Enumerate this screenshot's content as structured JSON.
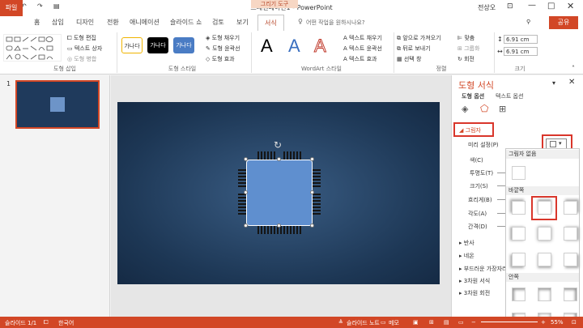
{
  "window": {
    "title": "프레젠테이션1 - PowerPoint",
    "context_tool": "그리기 도구",
    "user": "전상오"
  },
  "tabs": [
    "파일",
    "홈",
    "삽입",
    "디자인",
    "전환",
    "애니메이션",
    "슬라이드 쇼",
    "검토",
    "보기",
    "서식"
  ],
  "tell_me": "어떤 작업을 원하시나요?",
  "share": "공유",
  "ribbon": {
    "insert_shapes": {
      "label": "도형 삽입",
      "edit": "도형 편집",
      "textbox": "텍스트 상자",
      "merge": "도형 병합"
    },
    "shape_styles": {
      "label": "도형 스타일",
      "samples": [
        "가나다",
        "가나다",
        "가나다"
      ],
      "fill": "도형 채우기",
      "outline": "도형 윤곽선",
      "effects": "도형 효과"
    },
    "wordart": {
      "label": "WordArt 스타일",
      "letters": [
        "A",
        "A",
        "A"
      ],
      "text_fill": "텍스트 채우기",
      "text_outline": "텍스트 윤곽선",
      "text_effects": "텍스트 효과"
    },
    "arrange": {
      "label": "정렬",
      "bring_forward": "앞으로 가져오기",
      "send_backward": "뒤로 보내기",
      "selection_pane": "선택 창",
      "align": "맞춤",
      "group": "그룹화",
      "rotate": "회전"
    },
    "size": {
      "label": "크기",
      "height": "6.91 cm",
      "width": "6.91 cm"
    }
  },
  "slides": {
    "number": "1"
  },
  "format_pane": {
    "title": "도형 서식",
    "tabs": [
      "도형 옵션",
      "텍스트 옵션"
    ],
    "shadow_section": "그림자",
    "properties": [
      "미리 설정(P)",
      "색(C)",
      "투명도(T)",
      "크기(S)",
      "흐리게(B)",
      "각도(A)",
      "간격(D)"
    ],
    "sections": [
      "반사",
      "네온",
      "부드러운 가장자리",
      "3차원 서식",
      "3차원 회전"
    ]
  },
  "shadow_dropdown": {
    "no_shadow": "그림자 없음",
    "outer": "바깥쪽",
    "inner": "안쪽"
  },
  "status_bar": {
    "slide": "슬라이드 1/1",
    "language": "한국어",
    "notes": "슬라이드 노트",
    "memo": "메모",
    "zoom": "55%"
  }
}
